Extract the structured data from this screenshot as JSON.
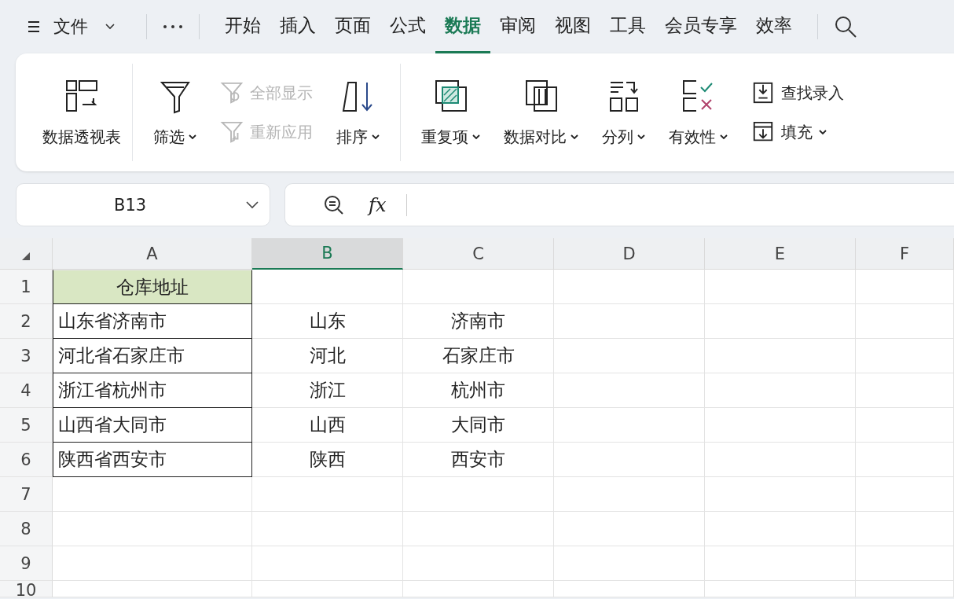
{
  "menu_bar": {
    "file_menu": "文件",
    "tabs": [
      {
        "label": "开始",
        "selected": false
      },
      {
        "label": "插入",
        "selected": false
      },
      {
        "label": "页面",
        "selected": false
      },
      {
        "label": "公式",
        "selected": false
      },
      {
        "label": "数据",
        "selected": true
      },
      {
        "label": "审阅",
        "selected": false
      },
      {
        "label": "视图",
        "selected": false
      },
      {
        "label": "工具",
        "selected": false
      },
      {
        "label": "会员专享",
        "selected": false
      },
      {
        "label": "效率",
        "selected": false
      }
    ]
  },
  "ribbon": {
    "groups": [
      {
        "items": [
          {
            "kind": "big",
            "label": "数据透视表",
            "dropdown": false
          }
        ]
      },
      {
        "items": [
          {
            "kind": "big",
            "label": "筛选",
            "dropdown": true
          },
          {
            "kind": "stack",
            "entries": [
              {
                "label": "全部显示",
                "disabled": true,
                "dropdown": false
              },
              {
                "label": "重新应用",
                "disabled": true,
                "dropdown": false
              }
            ]
          },
          {
            "kind": "big",
            "label": "排序",
            "dropdown": true
          }
        ]
      },
      {
        "items": [
          {
            "kind": "big",
            "label": "重复项",
            "dropdown": true
          },
          {
            "kind": "big",
            "label": "数据对比",
            "dropdown": true
          },
          {
            "kind": "big",
            "label": "分列",
            "dropdown": true
          },
          {
            "kind": "big",
            "label": "有效性",
            "dropdown": true
          },
          {
            "kind": "stack",
            "entries": [
              {
                "label": "查找录入",
                "disabled": false,
                "dropdown": false
              },
              {
                "label": "填充",
                "disabled": false,
                "dropdown": true
              }
            ]
          }
        ]
      }
    ]
  },
  "formula_bar": {
    "name_box": "B13",
    "function_label": "fx"
  },
  "sheet": {
    "columns": [
      {
        "label": "A",
        "selected": false
      },
      {
        "label": "B",
        "selected": true
      },
      {
        "label": "C",
        "selected": false
      },
      {
        "label": "D",
        "selected": false
      },
      {
        "label": "E",
        "selected": false
      },
      {
        "label": "F",
        "selected": false
      }
    ],
    "rows": [
      {
        "number": "1",
        "kind": "header",
        "a": "仓库地址"
      },
      {
        "number": "2",
        "kind": "data",
        "a": "山东省济南市",
        "b": "山东",
        "c": "济南市"
      },
      {
        "number": "3",
        "kind": "data",
        "a": "河北省石家庄市",
        "b": "河北",
        "c": "石家庄市"
      },
      {
        "number": "4",
        "kind": "data",
        "a": "浙江省杭州市",
        "b": "浙江",
        "c": "杭州市"
      },
      {
        "number": "5",
        "kind": "data",
        "a": "山西省大同市",
        "b": "山西",
        "c": "大同市"
      },
      {
        "number": "6",
        "kind": "data",
        "a": "陕西省西安市",
        "b": "陕西",
        "c": "西安市"
      },
      {
        "number": "7",
        "kind": "blank"
      },
      {
        "number": "8",
        "kind": "blank"
      },
      {
        "number": "9",
        "kind": "blank"
      },
      {
        "number": "10",
        "kind": "blank"
      }
    ]
  }
}
